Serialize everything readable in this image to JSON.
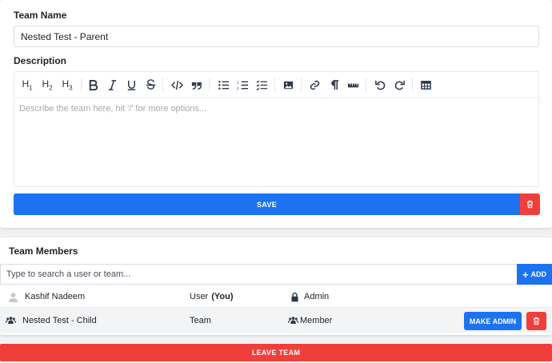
{
  "team_form": {
    "name_label": "Team Name",
    "name_value": "Nested Test - Parent",
    "description_label": "Description",
    "description_placeholder": "Describe the team here, hit '/' for more options...",
    "save_label": "SAVE"
  },
  "toolbar": {
    "buttons": [
      {
        "icon": "heading-1-icon",
        "text": "H",
        "sub": "1"
      },
      {
        "icon": "heading-2-icon",
        "text": "H",
        "sub": "2"
      },
      {
        "icon": "heading-3-icon",
        "text": "H",
        "sub": "3"
      },
      {
        "icon": "bold-icon"
      },
      {
        "icon": "italic-icon"
      },
      {
        "icon": "underline-icon"
      },
      {
        "icon": "strikethrough-icon"
      },
      {
        "icon": "code-icon"
      },
      {
        "icon": "quote-icon"
      },
      {
        "icon": "bullet-list-icon"
      },
      {
        "icon": "ordered-list-icon"
      },
      {
        "icon": "task-list-icon"
      },
      {
        "icon": "image-icon"
      },
      {
        "icon": "link-icon"
      },
      {
        "icon": "paragraph-icon"
      },
      {
        "icon": "ruler-icon"
      },
      {
        "icon": "undo-icon"
      },
      {
        "icon": "redo-icon"
      },
      {
        "icon": "table-icon"
      }
    ]
  },
  "members": {
    "title": "Team Members",
    "search_placeholder": "Type to search a user or team...",
    "add_label": "ADD",
    "rows": [
      {
        "name": "Kashif Nadeem",
        "type": "User",
        "type_suffix": "(You)",
        "role": "Admin",
        "icon": "user-avatar-icon",
        "role_icon": "lock-icon"
      },
      {
        "name": "Nested Test - Child",
        "type": "Team",
        "role": "Member",
        "icon": "team-icon",
        "role_icon": "users-icon",
        "make_admin_label": "MAKE ADMIN"
      }
    ],
    "leave_label": "LEAVE TEAM"
  },
  "colors": {
    "primary": "#1d72f2",
    "danger": "#f03f3b"
  }
}
